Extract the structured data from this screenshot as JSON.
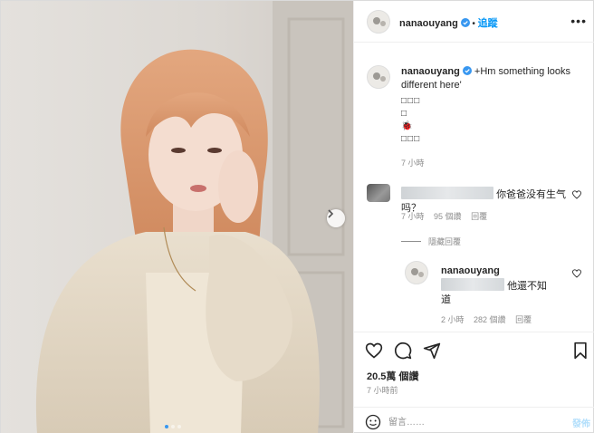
{
  "post": {
    "author": "nanaouyang",
    "follow_label": "追蹤",
    "more_icon": "more-horizontal-icon"
  },
  "caption": {
    "username": "nanaouyang",
    "text": "+Hm something looks different here'",
    "emoji_lines": [
      "□□□",
      "□",
      "🐞",
      "□□□"
    ],
    "time": "7 小時"
  },
  "comment1": {
    "text": "你爸爸没有生气吗？",
    "time": "7 小時",
    "likes": "95 個讚",
    "reply_label": "回覆",
    "hidden_replies_label": "隱藏回覆"
  },
  "reply1": {
    "username": "nanaouyang",
    "text_part1": "他還不知",
    "text_part2": "道",
    "time": "2 小時",
    "likes": "282 個讚",
    "reply_label": "回覆"
  },
  "stats": {
    "views": "20.5萬 個讚",
    "time_ago": "7 小時前"
  },
  "add_comment": {
    "placeholder": "留言……",
    "post_label": "發佈"
  },
  "carousel": {
    "dots": 3,
    "active": 0
  },
  "colors": {
    "accent": "#0095f6",
    "verified": "#3897f0",
    "muted": "#8e8e8e"
  }
}
